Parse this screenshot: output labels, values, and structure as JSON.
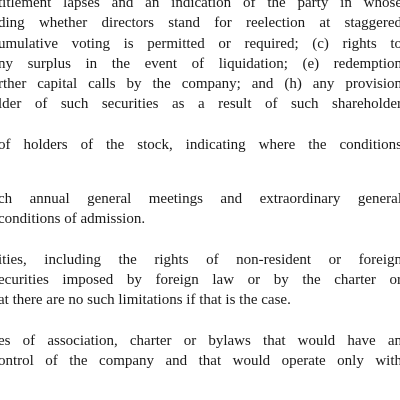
{
  "document": {
    "paragraphs": [
      {
        "lines": [
          "titlement lapses and an indication of the party in whose",
          "ding whether directors stand for reelection at staggered",
          "umulative voting is permitted or required; (c) rights to",
          "ny surplus in the event of liquidation; (e) redemption",
          "rther capital calls by the company; and (h) any provision",
          "lder of such securities as a result of such shareholder"
        ]
      },
      {
        "lines": [
          "of holders of the stock, indicating where the conditions"
        ]
      },
      {
        "lines": [
          "ch annual general meetings and extraordinary general",
          "conditions of admission."
        ]
      },
      {
        "lines": [
          "ities, including the rights of non-resident or foreign",
          "ecurities imposed by foreign law or by the charter or",
          "at there are no such limitations if that is the case."
        ]
      },
      {
        "lines": [
          "es of association, charter or bylaws that would have an",
          "ontrol of the company and that would operate only with"
        ]
      }
    ]
  }
}
